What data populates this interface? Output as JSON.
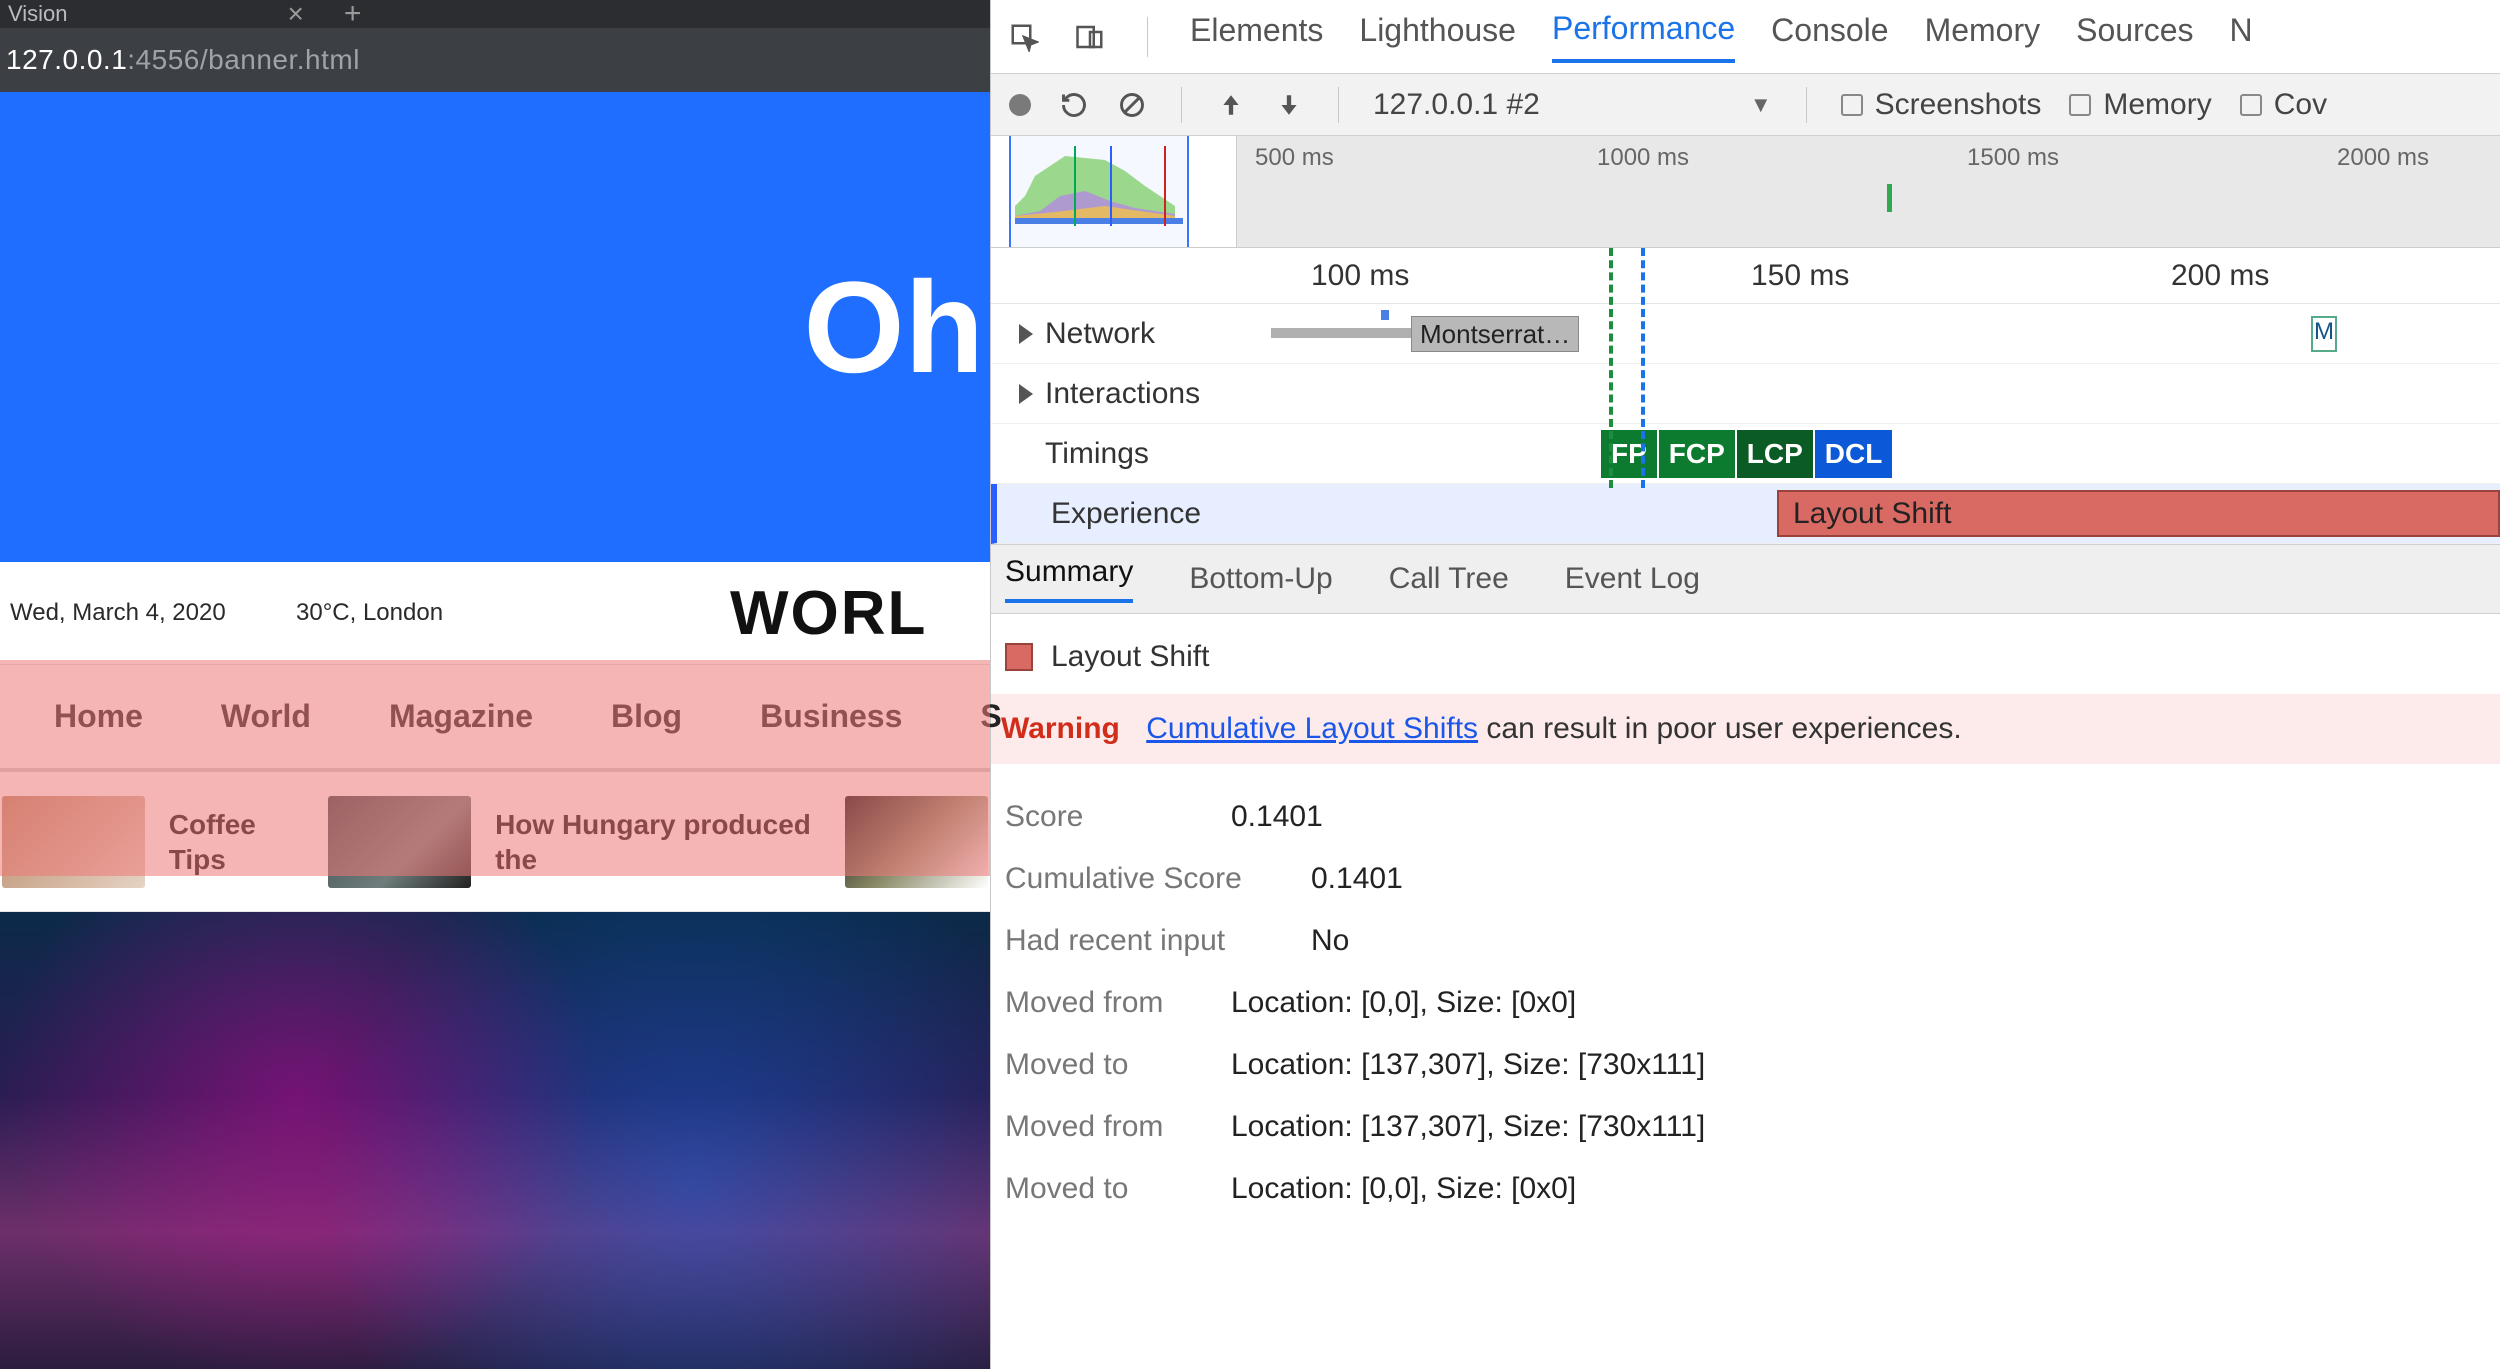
{
  "browser": {
    "tab_title": "Vision",
    "url_prefix": "127.0.0.1",
    "url_suffix": ":4556/banner.html",
    "banner_text": "Oh",
    "date": "Wed, March 4, 2020",
    "weather": "30°C, London",
    "site_title": "WORL",
    "nav": [
      "Home",
      "World",
      "Magazine",
      "Blog",
      "Business",
      "S"
    ],
    "thumbs": [
      {
        "title": "Coffee Tips"
      },
      {
        "title": "How Hungary produced the"
      }
    ]
  },
  "devtools": {
    "tabs": [
      "Elements",
      "Lighthouse",
      "Performance",
      "Console",
      "Memory",
      "Sources",
      "N"
    ],
    "active_tab": "Performance",
    "toolbar": {
      "target": "127.0.0.1 #2",
      "checkboxes": [
        "Screenshots",
        "Memory",
        "Cov"
      ]
    },
    "overview_ticks": [
      "500 ms",
      "1000 ms",
      "1500 ms",
      "2000 ms"
    ],
    "ruler_ticks": [
      "100 ms",
      "150 ms",
      "200 ms"
    ],
    "lanes": {
      "network": "Network",
      "network_chip": "Montserrat…",
      "network_m": "M",
      "interactions": "Interactions",
      "timings": "Timings",
      "timing_badges": [
        "FP",
        "FCP",
        "LCP",
        "DCL"
      ],
      "experience": "Experience",
      "experience_event": "Layout Shift"
    },
    "detail_tabs": [
      "Summary",
      "Bottom-Up",
      "Call Tree",
      "Event Log"
    ],
    "active_detail_tab": "Summary",
    "detail": {
      "header": "Layout Shift",
      "warning_label": "Warning",
      "warning_link": "Cumulative Layout Shifts",
      "warning_rest": " can result in poor user experiences.",
      "rows": [
        {
          "k": "Score",
          "v": "0.1401"
        },
        {
          "k": "Cumulative Score",
          "v": "0.1401"
        },
        {
          "k": "Had recent input",
          "v": "No"
        },
        {
          "k": "Moved from",
          "v": "Location: [0,0], Size: [0x0]"
        },
        {
          "k": "Moved to",
          "v": "Location: [137,307], Size: [730x111]"
        },
        {
          "k": "Moved from",
          "v": "Location: [137,307], Size: [730x111]"
        },
        {
          "k": "Moved to",
          "v": "Location: [0,0], Size: [0x0]"
        }
      ]
    }
  }
}
